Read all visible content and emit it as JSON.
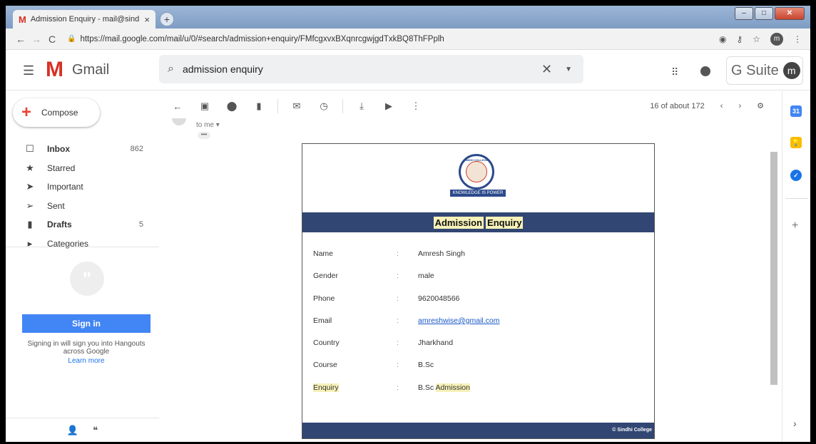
{
  "browser": {
    "tab_title": "Admission Enquiry - mail@sindhi",
    "tab_close": "×",
    "new_tab": "+",
    "url": "https://mail.google.com/mail/u/0/#search/admission+enquiry/FMfcgxvxBXqnrcgwjgdTxkBQ8ThFPplh",
    "profile_initial": "m"
  },
  "gmail": {
    "app_name": "Gmail",
    "search_value": "admission enquiry",
    "gsuite_label": "G Suite",
    "avatar_initial": "m"
  },
  "sidebar": {
    "compose_label": "Compose",
    "items": [
      {
        "label": "Inbox",
        "count": "862",
        "icon": "inbox-icon",
        "bold": true
      },
      {
        "label": "Starred",
        "count": "",
        "icon": "star-icon",
        "bold": false
      },
      {
        "label": "Important",
        "count": "",
        "icon": "important-icon",
        "bold": false
      },
      {
        "label": "Sent",
        "count": "",
        "icon": "send-icon",
        "bold": false
      },
      {
        "label": "Drafts",
        "count": "5",
        "icon": "draft-icon",
        "bold": true
      },
      {
        "label": "Categories",
        "count": "",
        "icon": "label-icon",
        "bold": false
      }
    ],
    "hangouts": {
      "sign_in_button": "Sign in",
      "sign_in_text": "Signing in will sign you into Hangouts across Google",
      "learn_more": "Learn more"
    }
  },
  "toolbar": {
    "pager_text": "16 of about 172"
  },
  "message": {
    "to_me": "to me ▾",
    "more_dots": "•••"
  },
  "email_card": {
    "motto": "KNOWLEDGE IS POWER",
    "seal_text": "SINDHI COLLEGE",
    "title_part1": "Admission",
    "title_part2": "Enquiry",
    "footer": "© Sindhi College",
    "fields": [
      {
        "label": "Name",
        "value": "Amresh Singh"
      },
      {
        "label": "Gender",
        "value": "male"
      },
      {
        "label": "Phone",
        "value": "9620048566"
      },
      {
        "label": "Email",
        "value": "amreshwise@gmail.com"
      },
      {
        "label": "Country",
        "value": "Jharkhand"
      },
      {
        "label": "Course",
        "value": "B.Sc"
      }
    ],
    "enquiry_label": "Enquiry",
    "enquiry_value_part1": "B.Sc",
    "enquiry_value_part2": "Admission",
    "colon": ":"
  },
  "colors": {
    "gmail_red": "#d93025",
    "banner_blue": "#314672",
    "highlight": "#f6f1b8",
    "sign_in_blue": "#4285f4"
  }
}
